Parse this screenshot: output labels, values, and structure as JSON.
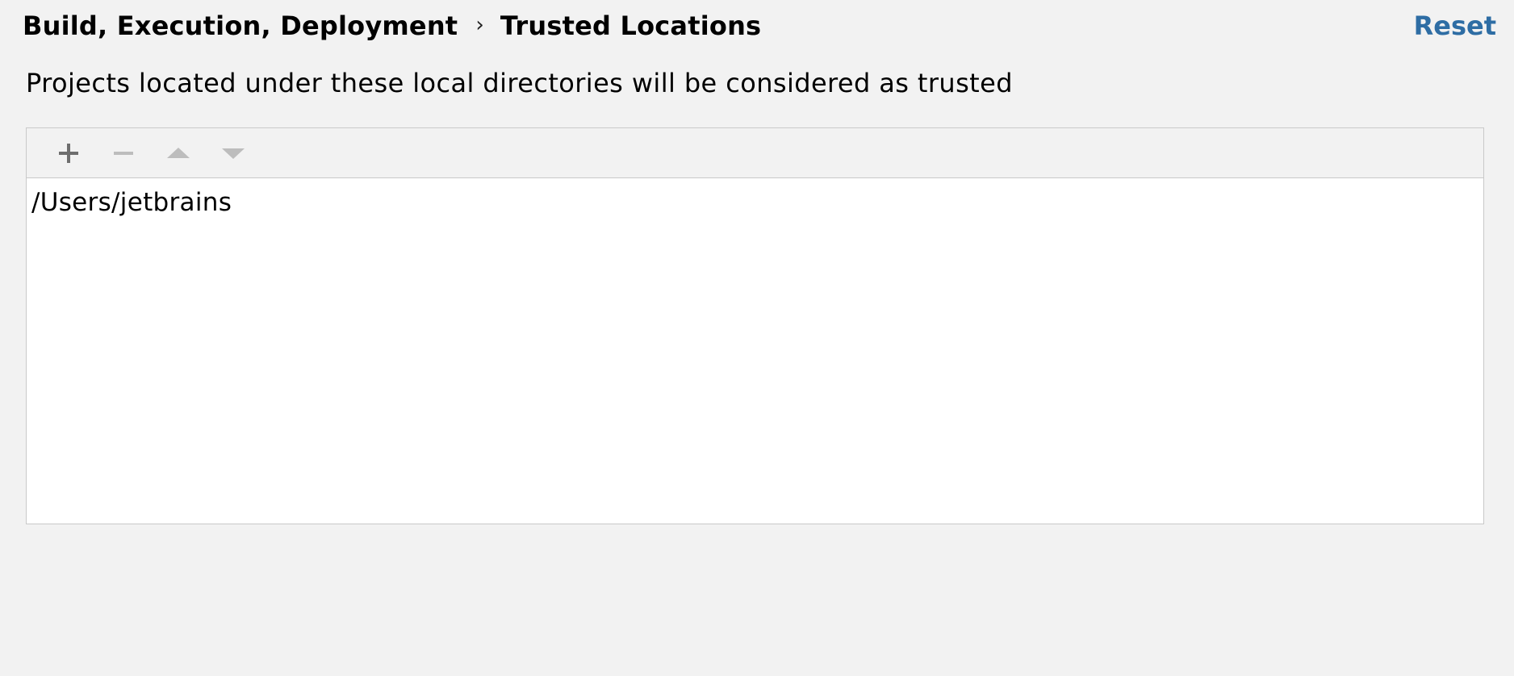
{
  "breadcrumb": {
    "parent": "Build, Execution, Deployment",
    "separator": "›",
    "current": "Trusted Locations"
  },
  "header": {
    "reset_label": "Reset"
  },
  "description": "Projects located under these local directories will be considered as trusted",
  "toolbar": {
    "buttons": [
      {
        "icon": "plus-icon",
        "enabled": true
      },
      {
        "icon": "minus-icon",
        "enabled": false
      },
      {
        "icon": "arrow-up-icon",
        "enabled": false
      },
      {
        "icon": "arrow-down-icon",
        "enabled": false
      }
    ]
  },
  "locations": [
    "/Users/jetbrains"
  ],
  "colors": {
    "background": "#f2f2f2",
    "link": "#2e6da4",
    "enabled_icon": "#6e6e6e",
    "disabled_icon": "#bdbdbd",
    "border": "#c9c9c9"
  }
}
